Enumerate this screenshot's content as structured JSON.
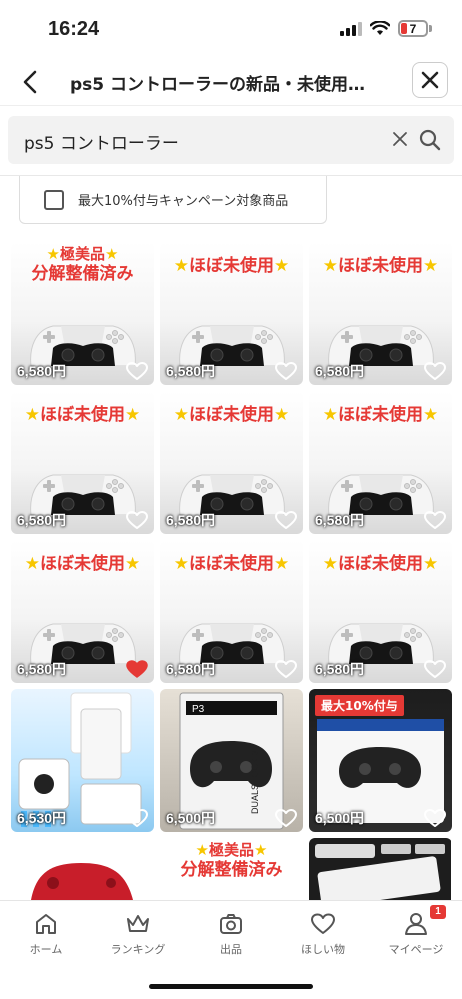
{
  "status_bar": {
    "time": "16:24",
    "battery": "7"
  },
  "header": {
    "title": "ps5 コントローラーの新品・未使用…"
  },
  "search": {
    "query": "ps5 コントローラー"
  },
  "filter": {
    "label": "最大10%付与キャンペーン対象商品"
  },
  "products": [
    {
      "banner_line1": "極美品",
      "banner_line2": "分解整備済み",
      "price": "6,580円",
      "liked": false
    },
    {
      "banner": "ほぼ未使用",
      "price": "6,580円",
      "liked": false
    },
    {
      "banner": "ほぼ未使用",
      "price": "6,580円",
      "liked": false
    },
    {
      "banner": "ほぼ未使用",
      "price": "6,580円",
      "liked": false
    },
    {
      "banner": "ほぼ未使用",
      "price": "6,580円",
      "liked": false
    },
    {
      "banner": "ほぼ未使用",
      "price": "6,580円",
      "liked": false
    },
    {
      "banner": "ほぼ未使用",
      "price": "6,580円",
      "liked": true
    },
    {
      "banner": "ほぼ未使用",
      "price": "6,580円",
      "liked": false
    },
    {
      "banner": "ほぼ未使用",
      "price": "6,580円",
      "liked": false
    },
    {
      "price": "6,530円",
      "liked": false
    },
    {
      "box_text": "P3",
      "box_brand": "DUALSHOCK 3",
      "price": "6,500円",
      "liked": false
    },
    {
      "badge": "最大10%付与",
      "price": "6,500円",
      "liked": false
    }
  ],
  "partial_products": [
    {
      "banner_line1": "極美品",
      "banner_line2": "分解整備済み"
    }
  ],
  "bottom_nav": {
    "home": "ホーム",
    "ranking": "ランキング",
    "sell": "出品",
    "wishlist": "ほしい物",
    "mypage": "マイページ",
    "mypage_badge": "1"
  },
  "colors": {
    "accent": "#e53935",
    "star": "#f7c600"
  }
}
